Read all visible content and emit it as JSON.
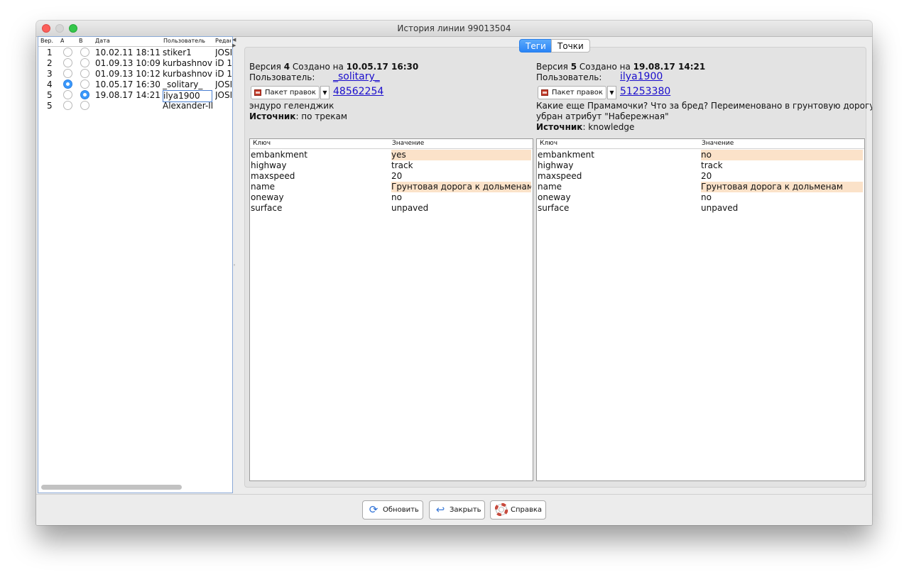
{
  "window": {
    "title": "История линии 99013504"
  },
  "left_table": {
    "headers": [
      "Вер.",
      "A",
      "B",
      "Дата",
      "Пользователь",
      "Редак"
    ],
    "rows": [
      {
        "ver": "1",
        "a": false,
        "b": false,
        "date": "10.02.11 18:11",
        "user": "stiker1",
        "editor": "JOSM"
      },
      {
        "ver": "2",
        "a": false,
        "b": false,
        "date": "01.09.13 10:09",
        "user": "kurbashnov",
        "editor": "iD 1"
      },
      {
        "ver": "3",
        "a": false,
        "b": false,
        "date": "01.09.13 10:12",
        "user": "kurbashnov",
        "editor": "iD 1"
      },
      {
        "ver": "4",
        "a": true,
        "b": false,
        "date": "10.05.17 16:30",
        "user": "_solitary_",
        "editor": "JOSM"
      },
      {
        "ver": "5",
        "a": false,
        "b": true,
        "date": "19.08.17 14:21",
        "user": "ilya1900",
        "editor": "JOSM"
      },
      {
        "ver": "5",
        "a": false,
        "b": false,
        "date": "",
        "user": "Alexander-II",
        "editor": ""
      }
    ]
  },
  "tabs": {
    "tags": "Теги",
    "points": "Точки"
  },
  "left_version": {
    "prefix": "Версия",
    "num": "4",
    "created": "Создано на",
    "datetime": "10.05.17 16:30",
    "user_label": "Пользователь:",
    "user": "_solitary_",
    "changeset_label": "Пакет правок",
    "changeset": "48562254",
    "comment": "эндуро геленджик",
    "source_label": "Источник",
    "source": ": по трекам"
  },
  "right_version": {
    "prefix": "Версия",
    "num": "5",
    "created": "Создано на",
    "datetime": "19.08.17 14:21",
    "user_label": "Пользователь:",
    "user": "ilya1900",
    "changeset_label": "Пакет правок",
    "changeset": "51253380",
    "comment_line1": "Какие еще Прамамочки? Что за бред? Переименовано в грунтовую дорогу,",
    "comment_line2": "убран атрибут \"Набережная\"",
    "source_label": "Источник",
    "source": ": knowledge"
  },
  "tags_left": {
    "headers": [
      "Ключ",
      "Значение"
    ],
    "rows": [
      {
        "key": "embankment",
        "value": "yes",
        "diff": true
      },
      {
        "key": "highway",
        "value": "track",
        "diff": false
      },
      {
        "key": "maxspeed",
        "value": "20",
        "diff": false
      },
      {
        "key": "name",
        "value": "Грунтовая дорога к дольменам...",
        "diff": true
      },
      {
        "key": "oneway",
        "value": "no",
        "diff": false
      },
      {
        "key": "surface",
        "value": "unpaved",
        "diff": false
      }
    ]
  },
  "tags_right": {
    "headers": [
      "Ключ",
      "Значение"
    ],
    "rows": [
      {
        "key": "embankment",
        "value": "no",
        "diff": true
      },
      {
        "key": "highway",
        "value": "track",
        "diff": false
      },
      {
        "key": "maxspeed",
        "value": "20",
        "diff": false
      },
      {
        "key": "name",
        "value": "Грунтовая дорога к дольменам",
        "diff": true
      },
      {
        "key": "oneway",
        "value": "no",
        "diff": false
      },
      {
        "key": "surface",
        "value": "unpaved",
        "diff": false
      }
    ]
  },
  "buttons": {
    "refresh": "Обновить",
    "close": "Закрыть",
    "help": "Справка"
  },
  "colors": {
    "accent": "#2a84f6",
    "diff_highlight": "#fbe2c9",
    "link": "#1a0dcc"
  }
}
